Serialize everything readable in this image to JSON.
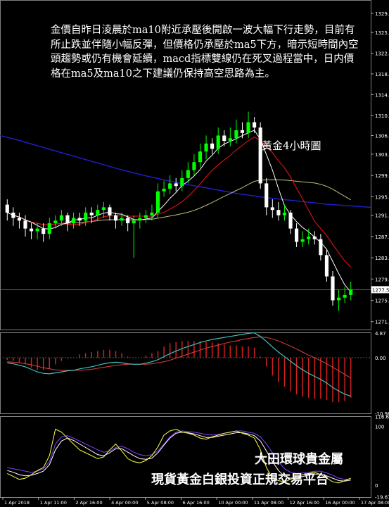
{
  "chart_data": {
    "type": "candlestick",
    "title": "黃金4小時圖",
    "commentary": "金價自昨日淩晨於ma10附近承壓後開啟一波大幅下行走勢，目前有所止跌並伴隨小幅反彈，但價格仍承壓於ma5下方，暗示短時間內空頭趨勢或仍有機會延續，macd指標雙線仍在死叉過程當中，日内價格在ma5及ma10之下建議仍保持高空思路為主。",
    "price_panel": {
      "y_ticks": [
        "1329.5",
        "1325.9",
        "1322.0",
        "1318.1",
        "1314.2",
        "1310.3",
        "1306.5",
        "1303.0",
        "1299.0",
        "1295.0",
        "1291.5",
        "1287.5",
        "1283.5",
        "1279.5",
        "1275.5",
        "1271.5"
      ],
      "current_price": "1277.5",
      "ylim": [
        1270,
        1332
      ],
      "open": [
        1293.5,
        1292.0,
        1291.0,
        1290.5,
        1289.0,
        1288.5,
        1289.0,
        1288.0,
        1290.0,
        1290.5,
        1291.5,
        1290.0,
        1291.0,
        1290.5,
        1292.0,
        1291.5,
        1292.5,
        1293.0,
        1291.5,
        1290.5,
        1291.0,
        1290.0,
        1290.5,
        1291.0,
        1291.5,
        1292.0,
        1296.0,
        1296.5,
        1297.5,
        1297.0,
        1298.5,
        1300.0,
        1301.5,
        1303.5,
        1305.0,
        1304.0,
        1306.5,
        1305.5,
        1306.0,
        1307.5,
        1307.0,
        1309.0,
        1308.0,
        1297.5,
        1293.0,
        1292.5,
        1291.5,
        1292.0,
        1289.0,
        1286.5,
        1287.0,
        1287.5,
        1287.0,
        1284.0,
        1280.0,
        1275.5,
        1276.0,
        1276.5
      ],
      "close": [
        1292.0,
        1291.0,
        1290.5,
        1289.0,
        1288.5,
        1289.0,
        1288.0,
        1290.0,
        1290.5,
        1291.5,
        1290.0,
        1291.0,
        1290.5,
        1292.0,
        1291.5,
        1292.5,
        1293.0,
        1291.5,
        1290.5,
        1291.0,
        1290.0,
        1290.5,
        1291.0,
        1291.5,
        1292.0,
        1296.0,
        1296.5,
        1297.5,
        1297.0,
        1298.5,
        1300.0,
        1301.5,
        1303.5,
        1305.0,
        1304.0,
        1306.5,
        1305.5,
        1306.0,
        1307.5,
        1307.0,
        1309.0,
        1308.0,
        1297.5,
        1293.0,
        1292.5,
        1291.5,
        1292.0,
        1289.0,
        1286.5,
        1287.0,
        1287.5,
        1287.0,
        1284.0,
        1280.0,
        1275.5,
        1276.0,
        1276.5,
        1277.5
      ],
      "high": [
        1294.5,
        1293.0,
        1292.0,
        1291.5,
        1290.0,
        1290.0,
        1290.0,
        1291.0,
        1291.5,
        1292.5,
        1292.0,
        1292.0,
        1292.0,
        1293.0,
        1293.0,
        1293.5,
        1294.0,
        1293.5,
        1292.0,
        1292.0,
        1291.5,
        1291.5,
        1292.0,
        1292.5,
        1293.5,
        1297.5,
        1298.0,
        1299.0,
        1298.5,
        1300.0,
        1301.5,
        1303.0,
        1305.0,
        1306.5,
        1306.0,
        1308.0,
        1307.5,
        1308.0,
        1309.5,
        1309.0,
        1311.0,
        1310.0,
        1309.0,
        1298.5,
        1294.5,
        1294.0,
        1293.5,
        1292.5,
        1290.0,
        1288.5,
        1289.0,
        1288.5,
        1288.0,
        1285.0,
        1281.0,
        1277.5,
        1278.0,
        1279.0
      ],
      "low": [
        1290.5,
        1289.5,
        1289.0,
        1287.5,
        1287.0,
        1287.0,
        1286.5,
        1287.0,
        1289.0,
        1289.5,
        1288.5,
        1289.0,
        1289.5,
        1289.5,
        1290.0,
        1290.5,
        1291.0,
        1290.5,
        1289.0,
        1289.5,
        1288.5,
        1283.5,
        1289.0,
        1290.0,
        1290.5,
        1291.0,
        1295.0,
        1295.5,
        1296.0,
        1296.0,
        1297.5,
        1299.0,
        1300.5,
        1302.0,
        1303.0,
        1303.0,
        1304.5,
        1304.5,
        1305.0,
        1306.0,
        1306.0,
        1307.0,
        1296.5,
        1291.5,
        1291.0,
        1290.5,
        1290.5,
        1288.0,
        1285.5,
        1285.5,
        1286.0,
        1286.0,
        1283.0,
        1279.0,
        1274.5,
        1273.5,
        1275.0,
        1275.5
      ],
      "ma_blue": [
        1306.5,
        1305.8,
        1305.0,
        1304.2,
        1303.4,
        1302.6,
        1301.8,
        1301.0,
        1300.2,
        1299.5,
        1298.8,
        1298.2,
        1297.6,
        1297.1,
        1296.6,
        1296.1,
        1295.6,
        1295.2,
        1294.8,
        1294.5,
        1294.2,
        1293.9,
        1293.6,
        1293.4,
        1293.2,
        1293.0
      ]
    },
    "macd_panel": {
      "y_ticks": [
        "4.87",
        "0.00",
        "-10.98"
      ],
      "macd": [
        -1.0,
        -1.2,
        -1.5,
        -1.8,
        -2.3,
        -2.8,
        -3.1,
        -3.2,
        -3.0,
        -2.8,
        -2.6,
        -2.5,
        -2.2,
        -2.0,
        -1.8,
        -1.5,
        -1.2,
        -1.0,
        -0.9,
        -1.0,
        -1.2,
        -1.3,
        -1.3,
        -1.1,
        -0.8,
        -0.4,
        0.2,
        0.8,
        1.3,
        1.8,
        2.2,
        2.6,
        3.0,
        3.3,
        3.6,
        3.8,
        4.0,
        4.2,
        4.4,
        4.6,
        4.8,
        4.9,
        4.2,
        3.2,
        2.1,
        1.1,
        0.2,
        -0.7,
        -1.6,
        -2.4,
        -3.1,
        -3.7,
        -4.3,
        -5.0,
        -5.9,
        -6.6,
        -7.2,
        -7.6
      ],
      "signal": [
        -0.8,
        -0.9,
        -1.0,
        -1.2,
        -1.4,
        -1.7,
        -2.0,
        -2.2,
        -2.4,
        -2.5,
        -2.5,
        -2.5,
        -2.5,
        -2.4,
        -2.3,
        -2.1,
        -1.9,
        -1.7,
        -1.5,
        -1.4,
        -1.3,
        -1.3,
        -1.3,
        -1.3,
        -1.2,
        -1.0,
        -0.8,
        -0.5,
        -0.1,
        0.3,
        0.7,
        1.1,
        1.5,
        1.9,
        2.2,
        2.5,
        2.8,
        3.1,
        3.3,
        3.6,
        3.8,
        4.0,
        4.1,
        4.0,
        3.7,
        3.3,
        2.8,
        2.3,
        1.7,
        1.1,
        0.5,
        0.0,
        -0.6,
        -1.2,
        -1.9,
        -2.6,
        -3.3,
        -4.0
      ]
    },
    "oscillator_panel": {
      "y_ticks": [
        "116.61",
        "100",
        "0",
        "-19.67"
      ],
      "fast": [
        20,
        15,
        10,
        12,
        18,
        25,
        30,
        50,
        95,
        90,
        80,
        70,
        60,
        55,
        50,
        45,
        48,
        60,
        70,
        58,
        45,
        40,
        38,
        42,
        50,
        65,
        85,
        92,
        95,
        90,
        88,
        85,
        80,
        78,
        82,
        85,
        88,
        90,
        92,
        88,
        85,
        80,
        60,
        30,
        12,
        8,
        6,
        10,
        15,
        18,
        20,
        22,
        18,
        12,
        6,
        4,
        8,
        12
      ],
      "slow": [
        25,
        22,
        18,
        16,
        17,
        20,
        24,
        35,
        60,
        75,
        80,
        76,
        70,
        64,
        58,
        52,
        50,
        55,
        62,
        62,
        56,
        50,
        45,
        44,
        46,
        55,
        68,
        80,
        88,
        90,
        89,
        87,
        84,
        81,
        81,
        83,
        85,
        87,
        89,
        89,
        87,
        84,
        75,
        58,
        40,
        25,
        15,
        12,
        13,
        15,
        17,
        19,
        19,
        16,
        12,
        8,
        7,
        9
      ],
      "third": [
        30,
        28,
        26,
        24,
        22,
        24,
        28,
        40,
        70,
        82,
        84,
        80,
        75,
        70,
        65,
        60,
        56,
        58,
        64,
        66,
        62,
        56,
        52,
        50,
        52,
        58,
        70,
        82,
        90,
        92,
        91,
        90,
        88,
        86,
        85,
        86,
        88,
        90,
        92,
        92,
        90,
        88,
        82,
        70,
        55,
        40,
        28,
        22,
        20,
        21,
        22,
        24,
        24,
        21,
        17,
        12,
        10,
        11
      ]
    },
    "x_ticks": [
      "1 Apr 2018",
      "1 Apr 11:00",
      "2 Apr 16:00",
      "4 Apr 00:00",
      "5 Apr 08:00",
      "6 Apr 16:00",
      "10 Apr 00:00",
      "11 Apr 08:00",
      "12 Apr 16:00",
      "16 Apr 00:00",
      "17 Apr 08:00"
    ],
    "brand": {
      "line1": "大田環球貴金屬",
      "line2": "現貨黃金白銀投資正規交易平台"
    },
    "colors": {
      "bull": "#00ff00",
      "bear": "#ffffff",
      "ma5": "#ffffff",
      "ma10": "#d01010",
      "ma_blue": "#2020d0",
      "ma_olive": "#bfbf80",
      "macd_line": "#40c0c0",
      "signal": "#e04040",
      "fast": "#ffff40",
      "slow": "#ffffff",
      "third": "#8040ff"
    }
  }
}
